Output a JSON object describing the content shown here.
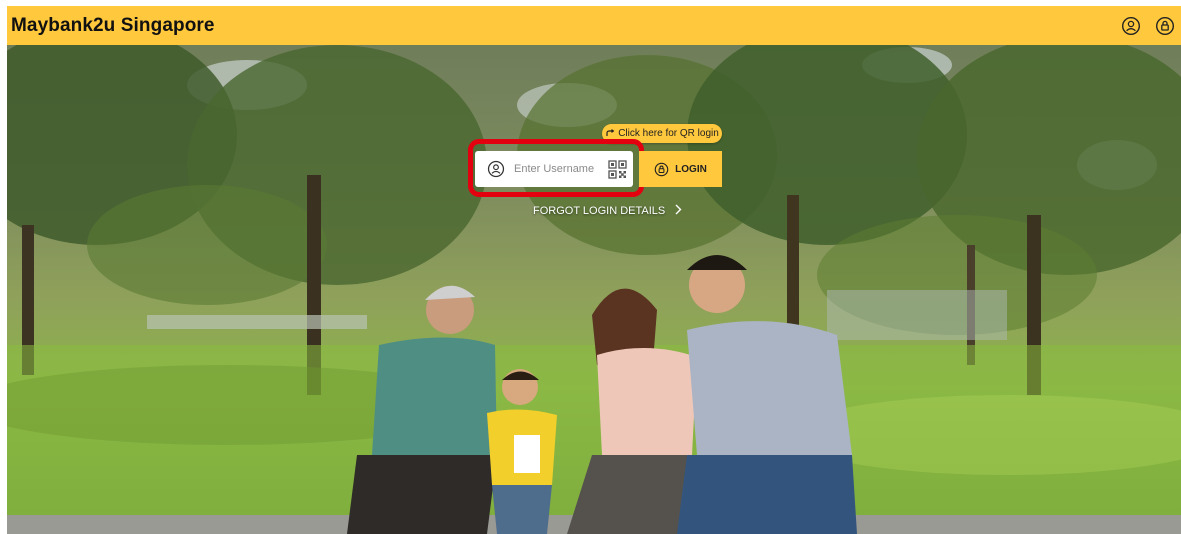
{
  "header": {
    "brand": "Maybank2u Singapore",
    "brand_color": "#ffc83d",
    "icons": [
      "user-circle-icon",
      "lock-circle-icon"
    ]
  },
  "login": {
    "qr_link_label": "Click here for QR login",
    "username_placeholder": "Enter Username",
    "login_button_label": "LOGIN",
    "forgot_label": "FORGOT LOGIN DETAILS",
    "highlight_color": "#e3000f"
  }
}
